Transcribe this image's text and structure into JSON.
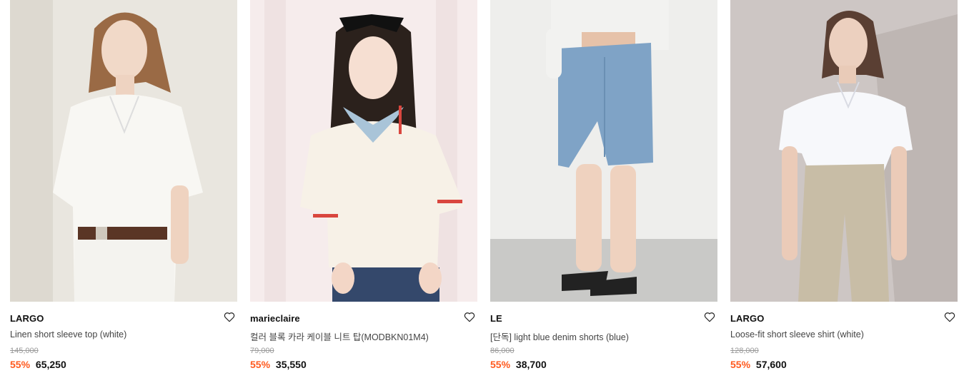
{
  "products": [
    {
      "brand": "LARGO",
      "name": "Linen short sleeve top (white)",
      "original_price": "145,000",
      "discount": "55%",
      "sale_price": "65,250",
      "wishlist_icon": "heart-outline-icon"
    },
    {
      "brand": "marieclaire",
      "name": "컬러 블록 카라 케이블 니트 탑(MODBKN01M4)",
      "original_price": "79,000",
      "discount": "55%",
      "sale_price": "35,550",
      "wishlist_icon": "heart-outline-icon"
    },
    {
      "brand": "LE",
      "name": "[단독] light blue denim shorts (blue)",
      "original_price": "86,000",
      "discount": "55%",
      "sale_price": "38,700",
      "wishlist_icon": "heart-outline-icon"
    },
    {
      "brand": "LARGO",
      "name": "Loose-fit short sleeve shirt (white)",
      "original_price": "128,000",
      "discount": "55%",
      "sale_price": "57,600",
      "wishlist_icon": "heart-outline-icon"
    }
  ],
  "colors": {
    "discount": "#ff5a1f",
    "brand_text": "#111111",
    "name_text": "#444444",
    "original_price_text": "#9a9a9a"
  }
}
